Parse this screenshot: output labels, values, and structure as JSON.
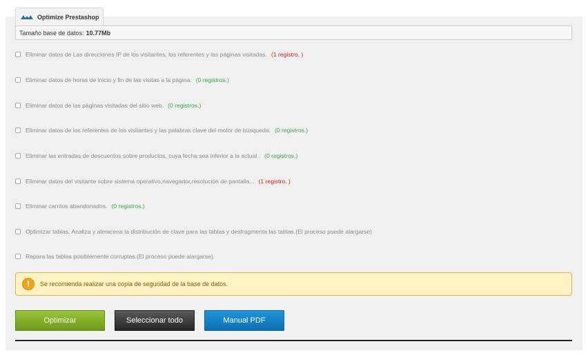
{
  "tab": {
    "label": "Optimize Prestashop",
    "icon": "prestashop-logo-icon"
  },
  "db_size": {
    "label": "Tamaño base de datos:",
    "value": "10.77Mb"
  },
  "options": [
    {
      "label": "Eliminar datos de Las direcciones IP de los visitantes, los referentes y las páginas visitadas.",
      "count": "(1 registro. )",
      "count_color": "red"
    },
    {
      "label": "Eliminar datos de horas de inicio y fin de las visitas a la página.",
      "count": "(0 registros.)",
      "count_color": "green"
    },
    {
      "label": "Eliminar datos de las páginas visitadas del sitio web.",
      "count": "(0 registros.)",
      "count_color": "green"
    },
    {
      "label": "Eliminar datos de los referentes de los visitantes y las palabras clave del motor de búsqueda.",
      "count": "(0 registros.)",
      "count_color": "green"
    },
    {
      "label": "Eliminar las entradas de descuentos sobre productos, cuya fecha sea inferior a la actual .",
      "count": "(0 registros.)",
      "count_color": "green"
    },
    {
      "label": "Eliminar datos del visitante sobre sistema operativo,navegador,resolución de pantalla...",
      "count": "(1 registro. )",
      "count_color": "red"
    },
    {
      "label": "Eliminar carritos abandonados.",
      "count": "(0 registros.)",
      "count_color": "green"
    },
    {
      "label": "Optimizar tablas. Analiza y almacena la distribución de clave para las tablas y desfragmenta las tablas.(El proceso puede alargarse)",
      "count": "",
      "count_color": ""
    },
    {
      "label": "Repara las tablas posiblemente corruptas.(El proceso puede alargarse)",
      "count": "",
      "count_color": ""
    }
  ],
  "warning": {
    "icon": "warning-icon",
    "text": "Se recomienda realizar una copia de seguridad de la base de datos."
  },
  "buttons": {
    "optimize": "Optimizar",
    "select_all": "Seleccionar todo",
    "manual": "Manual PDF"
  },
  "colors": {
    "count_red": "#d11f1f",
    "count_green": "#3ba94a",
    "optimize_button": "#7fab25",
    "select_button": "#3a3a3a",
    "manual_button": "#1482c8",
    "warning_bg": "#fdf2c2"
  }
}
